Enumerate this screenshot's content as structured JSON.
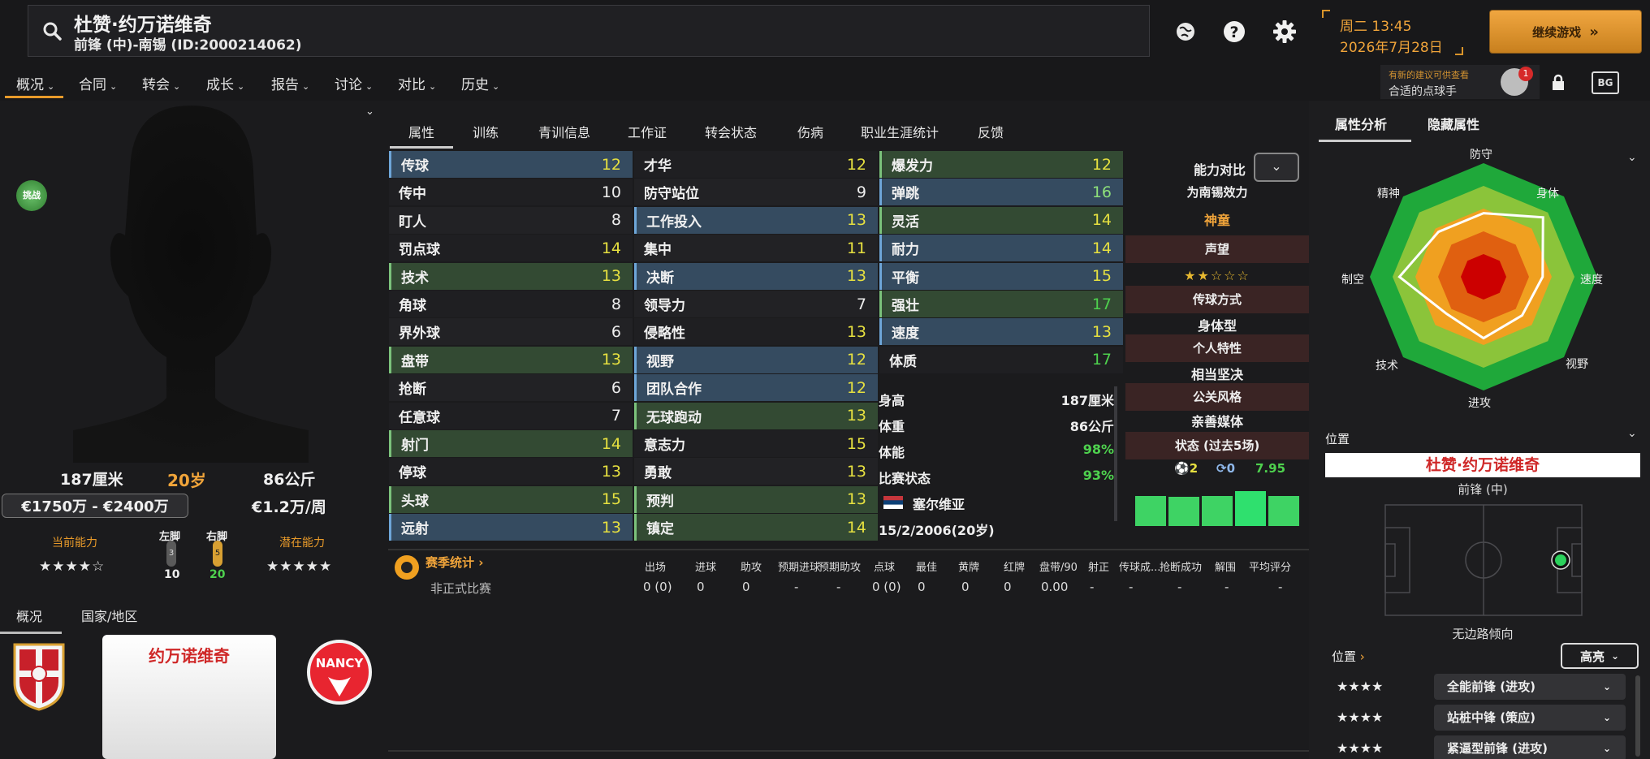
{
  "header": {
    "player_name": "杜赞·约万诺维奇",
    "player_sub": "前锋 (中)-南锡 (ID:2000214062)",
    "time": "周二 13:45",
    "date": "2026年7月28日",
    "continue_label": "继续游戏",
    "suggest_line1": "有新的建议可供查看",
    "suggest_line2": "合适的点球手",
    "suggest_count": "1",
    "bg_label": "BG"
  },
  "nav": [
    "概况",
    "合同",
    "转会",
    "成长",
    "报告",
    "讨论",
    "对比",
    "历史"
  ],
  "profile": {
    "challenge": "挑战",
    "height": "187厘米",
    "age": "20岁",
    "weight": "86公斤",
    "value": "€1750万 - €2400万",
    "wage": "€1.2万/周",
    "current_ability_label": "当前能力",
    "potential_label": "潜在能力",
    "current_stars": "★★★★☆",
    "potential_stars": "★★★★★",
    "left_foot_label": "左脚",
    "right_foot_label": "右脚",
    "left_foot_val": "3",
    "right_foot_val": "5",
    "left_foot_num": "10",
    "right_foot_num": "20",
    "tabs": [
      "概况",
      "国家/地区"
    ],
    "card_name": "约万诺维奇",
    "club_text": "NANCY"
  },
  "center_tabs": [
    "属性",
    "训练",
    "青训信息",
    "工作证",
    "转会状态",
    "伤病",
    "职业生涯统计",
    "反馈"
  ],
  "attrs": {
    "technical": [
      {
        "name": "传球",
        "val": "12",
        "hl": "blue",
        "c": "yellow"
      },
      {
        "name": "传中",
        "val": "10",
        "hl": "none",
        "c": "white"
      },
      {
        "name": "盯人",
        "val": "8",
        "hl": "plain",
        "c": "white"
      },
      {
        "name": "罚点球",
        "val": "14",
        "hl": "none",
        "c": "yellow"
      },
      {
        "name": "技术",
        "val": "13",
        "hl": "green",
        "c": "yellow"
      },
      {
        "name": "角球",
        "val": "8",
        "hl": "none",
        "c": "white"
      },
      {
        "name": "界外球",
        "val": "6",
        "hl": "plain",
        "c": "white"
      },
      {
        "name": "盘带",
        "val": "13",
        "hl": "green",
        "c": "yellow"
      },
      {
        "name": "抢断",
        "val": "6",
        "hl": "plain",
        "c": "white"
      },
      {
        "name": "任意球",
        "val": "7",
        "hl": "none",
        "c": "white"
      },
      {
        "name": "射门",
        "val": "14",
        "hl": "green",
        "c": "yellow"
      },
      {
        "name": "停球",
        "val": "13",
        "hl": "none",
        "c": "yellow"
      },
      {
        "name": "头球",
        "val": "15",
        "hl": "green",
        "c": "yellow"
      },
      {
        "name": "远射",
        "val": "13",
        "hl": "blue",
        "c": "yellow"
      }
    ],
    "mental": [
      {
        "name": "才华",
        "val": "12",
        "hl": "none",
        "c": "yellow"
      },
      {
        "name": "防守站位",
        "val": "9",
        "hl": "plain",
        "c": "white"
      },
      {
        "name": "工作投入",
        "val": "13",
        "hl": "blue",
        "c": "yellow"
      },
      {
        "name": "集中",
        "val": "11",
        "hl": "plain",
        "c": "yellow"
      },
      {
        "name": "决断",
        "val": "13",
        "hl": "blue",
        "c": "yellow"
      },
      {
        "name": "领导力",
        "val": "7",
        "hl": "plain",
        "c": "white"
      },
      {
        "name": "侵略性",
        "val": "13",
        "hl": "none",
        "c": "yellow"
      },
      {
        "name": "视野",
        "val": "12",
        "hl": "blue",
        "c": "yellow"
      },
      {
        "name": "团队合作",
        "val": "12",
        "hl": "blue",
        "c": "yellow"
      },
      {
        "name": "无球跑动",
        "val": "13",
        "hl": "green",
        "c": "yellow"
      },
      {
        "name": "意志力",
        "val": "15",
        "hl": "none",
        "c": "yellow"
      },
      {
        "name": "勇敢",
        "val": "13",
        "hl": "plain",
        "c": "yellow"
      },
      {
        "name": "预判",
        "val": "13",
        "hl": "green",
        "c": "yellow"
      },
      {
        "name": "镇定",
        "val": "14",
        "hl": "green",
        "c": "yellow"
      }
    ],
    "physical": [
      {
        "name": "爆发力",
        "val": "12",
        "hl": "green",
        "c": "yellow"
      },
      {
        "name": "弹跳",
        "val": "16",
        "hl": "blue",
        "c": "lgreen"
      },
      {
        "name": "灵活",
        "val": "14",
        "hl": "green",
        "c": "yellow"
      },
      {
        "name": "耐力",
        "val": "14",
        "hl": "blue",
        "c": "yellow"
      },
      {
        "name": "平衡",
        "val": "15",
        "hl": "blue",
        "c": "yellow"
      },
      {
        "name": "强壮",
        "val": "17",
        "hl": "green",
        "c": "green"
      },
      {
        "name": "速度",
        "val": "13",
        "hl": "blue",
        "c": "yellow"
      },
      {
        "name": "体质",
        "val": "17",
        "hl": "none",
        "c": "green"
      }
    ]
  },
  "info": {
    "height_label": "身高",
    "height_val": "187厘米",
    "weight_label": "体重",
    "weight_val": "86公斤",
    "fitness_label": "体能",
    "fitness_val": "98%",
    "match_label": "比赛状态",
    "match_val": "93%",
    "nation": "塞尔维亚",
    "dob": "15/2/2006(20岁)"
  },
  "compare": {
    "title": "能力对比",
    "playing_for": "为南锡效力",
    "playing_for_val": "神童",
    "reputation": "声望",
    "reputation_stars": "★★☆☆☆",
    "pass_style": "传球方式",
    "pass_style_val": "身体型",
    "personality": "个人特性",
    "personality_val": "相当坚决",
    "media": "公关风格",
    "media_val": "亲善媒体",
    "form": "状态 (过去5场)",
    "goals": "2",
    "assists": "0",
    "rating": "7.95",
    "form_bars": [
      0.72,
      0.7,
      0.72,
      0.82,
      0.72
    ]
  },
  "season": {
    "title": "赛季统计",
    "headers": [
      "出场",
      "进球",
      "助攻",
      "预期进球",
      "预期助攻",
      "点球",
      "最佳",
      "黄牌",
      "红牌",
      "盘带/90",
      "射正",
      "传球成...",
      "抢断成功",
      "解围",
      "平均评分"
    ],
    "row_label": "非正式比赛",
    "values": [
      "0 (0)",
      "0",
      "0",
      "-",
      "-",
      "0 (0)",
      "0",
      "0",
      "0",
      "0.00",
      "-",
      "-",
      "-",
      "-",
      "-"
    ]
  },
  "right": {
    "tabs": [
      "属性分析",
      "隐藏属性"
    ],
    "radar_labels": [
      "防守",
      "身体",
      "速度",
      "视野",
      "进攻",
      "技术",
      "制空",
      "精神"
    ],
    "radar_values": [
      0.56,
      0.74,
      0.52,
      0.48,
      0.54,
      0.46,
      0.74,
      0.56
    ],
    "pos_title": "位置",
    "pos_name": "杜赞·约万诺维奇",
    "pos_sub": "前锋 (中)",
    "wing": "无边路倾向",
    "pos2_title": "位置",
    "highlight": "高亮",
    "roles": [
      {
        "stars": "★★★★",
        "name": "全能前锋 (进攻)"
      },
      {
        "stars": "★★★★",
        "name": "站桩中锋 (策应)"
      },
      {
        "stars": "★★★★",
        "name": "紧逼型前锋 (进攻)"
      }
    ]
  },
  "colors": {
    "accent": "#e89a2a",
    "radar_outer": "#1fa83a",
    "radar_mid": "#8bc43a",
    "radar_inner": "#f0a020",
    "radar_core": "#cc0000"
  }
}
